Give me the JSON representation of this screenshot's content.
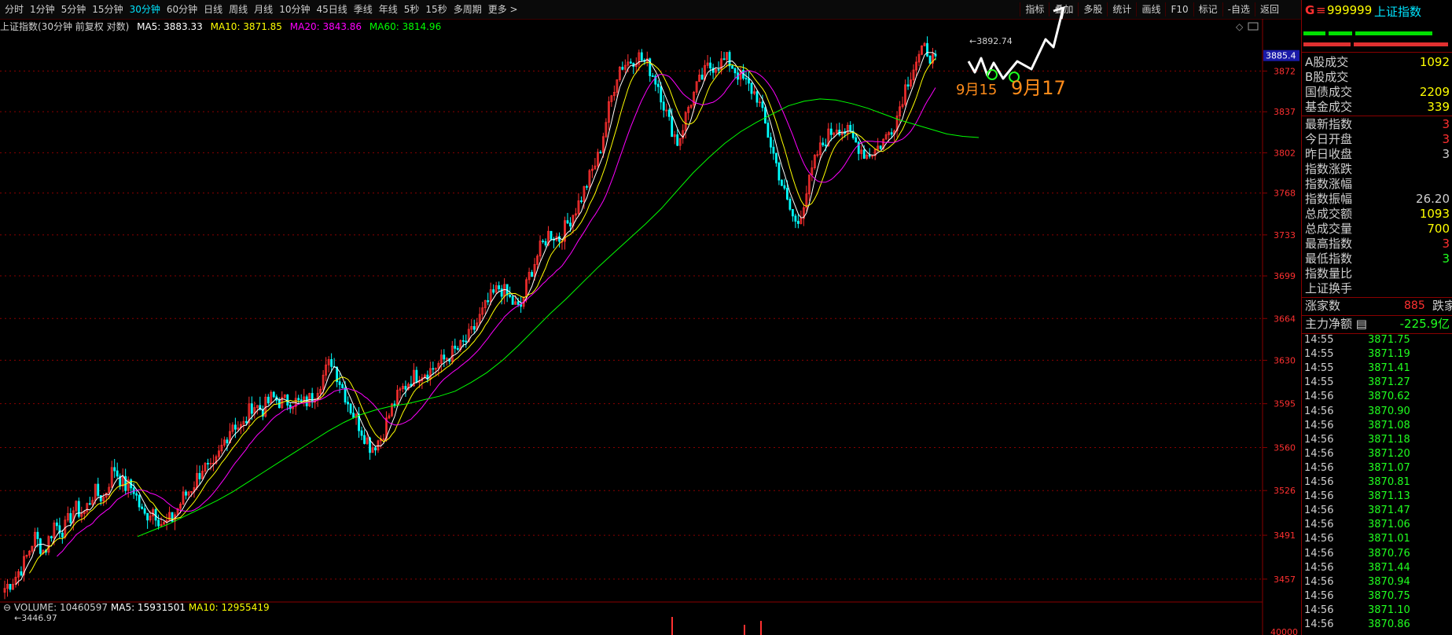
{
  "periods": [
    "分时",
    "1分钟",
    "5分钟",
    "15分钟",
    "30分钟",
    "60分钟",
    "日线",
    "周线",
    "月线",
    "10分钟",
    "45日线",
    "季线",
    "年线",
    "5秒",
    "15秒",
    "多周期",
    "更多 >"
  ],
  "active_period": "30分钟",
  "tools": [
    "指标",
    "叠加",
    "多股",
    "统计",
    "画线",
    "F10",
    "标记",
    "-自选",
    "返回"
  ],
  "info": {
    "title": "上证指数(30分钟 前复权 对数)",
    "ma5": "MA5: 3883.33",
    "ma10": "MA10: 3871.85",
    "ma20": "MA20: 3843.86",
    "ma60": "MA60: 3814.96"
  },
  "volume_info": {
    "volume": "VOLUME: 10460597",
    "ma5": "MA5: 15931501",
    "ma10": "MA10: 12955419"
  },
  "annotations": {
    "sep15": "9月15",
    "sep17": "9月17"
  },
  "colors": {
    "up": "#ff3030",
    "down": "#00ffff",
    "ma5": "#ffffff",
    "ma10": "#ffff00",
    "ma20": "#ff00ff",
    "ma60": "#00ff00",
    "grid": "#8a0000",
    "annotation": "#ff8c1a"
  },
  "chart_data": {
    "type": "candlestick",
    "title": "上证指数(30分钟 前复权 对数)",
    "ytick_labels": [
      "3872",
      "3837",
      "3802",
      "3768",
      "3733",
      "3699",
      "3664",
      "3630",
      "3595",
      "3560",
      "3526",
      "3491",
      "3457"
    ],
    "ylim": [
      3440,
      3905
    ],
    "current_price_label": "3885.4",
    "high_label": "3892.74",
    "low_label": "3446.97",
    "volume_tick_label": "40000",
    "close_path": [
      3450,
      3458,
      3470,
      3490,
      3478,
      3500,
      3495,
      3512,
      3508,
      3525,
      3520,
      3545,
      3530,
      3528,
      3505,
      3512,
      3498,
      3505,
      3520,
      3530,
      3545,
      3540,
      3562,
      3580,
      3575,
      3595,
      3590,
      3600,
      3596,
      3598,
      3594,
      3600,
      3615,
      3630,
      3610,
      3590,
      3575,
      3560,
      3568,
      3590,
      3605,
      3615,
      3620,
      3622,
      3628,
      3635,
      3640,
      3650,
      3665,
      3680,
      3690,
      3680,
      3670,
      3700,
      3720,
      3735,
      3730,
      3745,
      3760,
      3780,
      3800,
      3840,
      3875,
      3880,
      3885,
      3876,
      3860,
      3830,
      3810,
      3840,
      3860,
      3875,
      3878,
      3882,
      3870,
      3860,
      3850,
      3820,
      3790,
      3760,
      3740,
      3770,
      3800,
      3815,
      3825,
      3820,
      3810,
      3800,
      3805,
      3815,
      3830,
      3860,
      3880,
      3892,
      3878
    ],
    "ma60_path": [
      3490,
      3495,
      3500,
      3506,
      3512,
      3518,
      3525,
      3533,
      3541,
      3549,
      3557,
      3565,
      3573,
      3580,
      3586,
      3590,
      3593,
      3595,
      3598,
      3601,
      3605,
      3612,
      3620,
      3630,
      3642,
      3655,
      3668,
      3680,
      3693,
      3706,
      3718,
      3730,
      3742,
      3755,
      3770,
      3785,
      3798,
      3810,
      3820,
      3828,
      3835,
      3842,
      3846,
      3848,
      3847,
      3844,
      3840,
      3835,
      3830,
      3826,
      3822,
      3818,
      3816,
      3815
    ],
    "volume_bars": [],
    "annotations": [
      "9月15",
      "9月17"
    ]
  }
}
